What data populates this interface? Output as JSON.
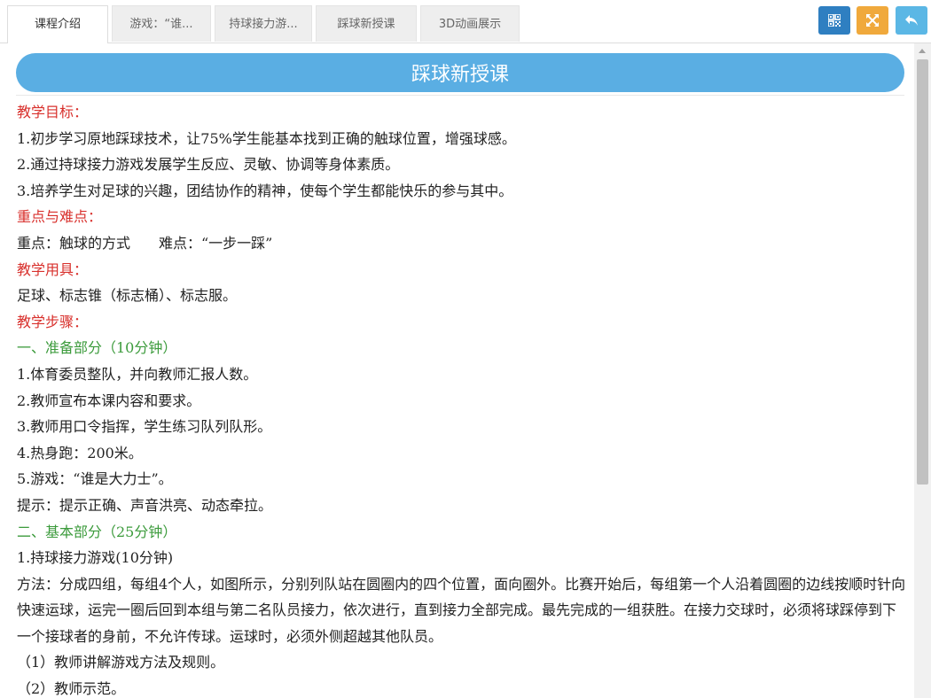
{
  "tabs": [
    {
      "label": "课程介绍",
      "active": true
    },
    {
      "label": "游戏：“谁...",
      "active": false
    },
    {
      "label": "持球接力游...",
      "active": false
    },
    {
      "label": "踩球新授课",
      "active": false
    },
    {
      "label": "3D动画展示",
      "active": false
    }
  ],
  "toolbar": {
    "qr_icon": "qr-code-icon",
    "fullscreen_icon": "fullscreen-icon",
    "back_icon": "back-arrow-icon",
    "colors": {
      "qr": "#2f7fc1",
      "fullscreen": "#f0a93c",
      "back": "#5bb7e5"
    }
  },
  "page": {
    "title": "踩球新授课",
    "title_bar_color": "#5aaee3",
    "lines": [
      {
        "text": "教学目标：",
        "style": "red"
      },
      {
        "text": "1.初步学习原地踩球技术，让75%学生能基本找到正确的触球位置，增强球感。",
        "style": "normal"
      },
      {
        "text": "2.通过持球接力游戏发展学生反应、灵敏、协调等身体素质。",
        "style": "normal"
      },
      {
        "text": "3.培养学生对足球的兴趣，团结协作的精神，使每个学生都能快乐的参与其中。",
        "style": "normal"
      },
      {
        "text": "重点与难点：",
        "style": "red"
      },
      {
        "text": "重点：触球的方式　　难点：“一步一踩”",
        "style": "normal"
      },
      {
        "text": "教学用具：",
        "style": "red"
      },
      {
        "text": "足球、标志锥（标志桶）、标志服。",
        "style": "normal"
      },
      {
        "text": "教学步骤：",
        "style": "red"
      },
      {
        "text": "一、准备部分（10分钟）",
        "style": "green"
      },
      {
        "text": "1.体育委员整队，并向教师汇报人数。",
        "style": "normal"
      },
      {
        "text": "2.教师宣布本课内容和要求。",
        "style": "normal"
      },
      {
        "text": "3.教师用口令指挥，学生练习队列队形。",
        "style": "normal"
      },
      {
        "text": "4.热身跑：200米。",
        "style": "normal"
      },
      {
        "text": "5.游戏：“谁是大力士”。",
        "style": "normal"
      },
      {
        "text": "提示：提示正确、声音洪亮、动态牵拉。",
        "style": "normal"
      },
      {
        "text": "二、基本部分（25分钟）",
        "style": "green"
      },
      {
        "text": "1.持球接力游戏(10分钟)",
        "style": "normal"
      },
      {
        "text": "方法：分成四组，每组4个人，如图所示，分别列队站在圆圈内的四个位置，面向圈外。比赛开始后，每组第一个人沿着圆圈的边线按顺时针向快速运球，运完一圈后回到本组与第二名队员接力，依次进行，直到接力全部完成。最先完成的一组获胜。在接力交球时，必须将球踩停到下一个接球者的身前，不允许传球。运球时，必须外侧超越其他队员。",
        "style": "normal"
      },
      {
        "text": "（1）教师讲解游戏方法及规则。",
        "style": "normal"
      },
      {
        "text": "（2）教师示范。",
        "style": "normal"
      }
    ]
  }
}
